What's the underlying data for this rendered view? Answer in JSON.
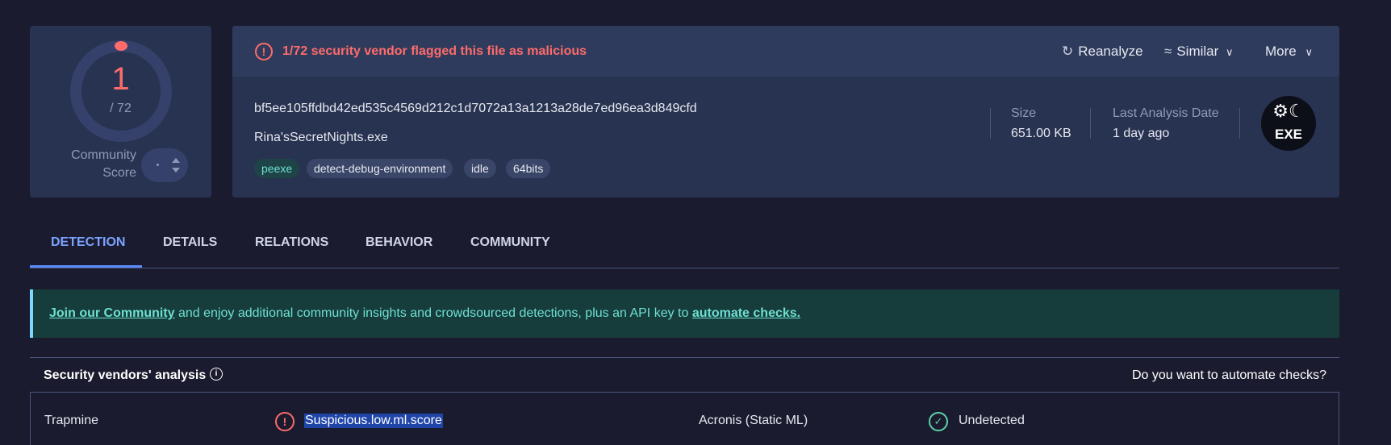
{
  "score": {
    "detected": "1",
    "total": "/ 72",
    "community_label_line1": "Community",
    "community_label_line2": "Score",
    "accent": "#ff6b6b"
  },
  "alert": {
    "icon": "alert-circle-icon",
    "text": "1/72 security vendor flagged this file as malicious"
  },
  "actions": {
    "reanalyze": "Reanalyze",
    "similar": "Similar",
    "more": "More"
  },
  "file": {
    "hash": "bf5ee105ffdbd42ed535c4569d212c1d7072a13a1213a28de7ed96ea3d849cfd",
    "name": "Rina'sSecretNights.exe",
    "tags": [
      "peexe",
      "detect-debug-environment",
      "idle",
      "64bits"
    ]
  },
  "meta": {
    "size_label": "Size",
    "size_value": "651.00 KB",
    "date_label": "Last Analysis Date",
    "date_value": "1 day ago"
  },
  "file_type": {
    "icon": "exe-file-icon",
    "ext": "EXE"
  },
  "tabs": [
    "DETECTION",
    "DETAILS",
    "RELATIONS",
    "BEHAVIOR",
    "COMMUNITY"
  ],
  "active_tab": "DETECTION",
  "banner": {
    "link1": "Join our Community",
    "middle": " and enjoy additional community insights and crowdsourced detections, plus an API key to ",
    "link2": "automate checks."
  },
  "vendors": {
    "title": "Security vendors' analysis",
    "automate_question": "Do you want to automate checks?",
    "rows": [
      {
        "vendor1": "Trapmine",
        "result1": "Suspicious.low.ml.score",
        "status1": "malicious",
        "vendor2": "Acronis (Static ML)",
        "result2": "Undetected",
        "status2": "undetected"
      }
    ]
  }
}
